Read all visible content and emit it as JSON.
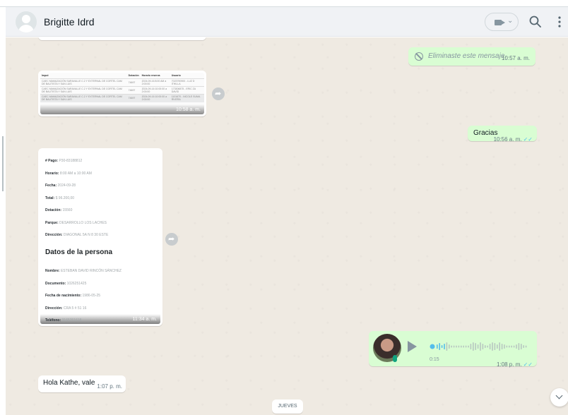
{
  "header": {
    "contact_name": "Brigitte Idrd",
    "avatar_icon": "default-user-avatar-icon",
    "video_icon": "video-camera-icon",
    "search_icon": "search-icon",
    "menu_icon": "kebab-menu-icon"
  },
  "messages": {
    "deleted": {
      "text": "Eliminaste este mensaje.",
      "time": "10:57 a. m.",
      "icon": "ban-icon"
    },
    "table_image": {
      "time": "10:58 a. m.",
      "headers": [
        "Imput",
        "Dotación",
        "Horario reserva",
        "Usuario"
      ],
      "rows": [
        [
          "CAEC MAMAZACIÓN SARAVALLE C.2 Y EXTERNAL DE CORTEL CAM DE BAUTISTA Y SAN LUIS",
          "74697",
          "2024-09-16 8:00 AM a 2:00:00",
          "7023790900 - LUZ D ITHILLA"
        ],
        [
          "CAEC MAMAZACIÓN SARAVALLE C.2 Y EXTERNAL DE CORTEL CAM DE BAUTISTA Y SAN LUIS",
          "74697",
          "2024-09-16 10:00:00 a 2:00:00",
          "173306875 - ERIC ZA DAVID"
        ],
        [
          "CAEC MAMAZACIÓN SARAVALLE C.2 Y EXTERNAL DE CORTEL CAM DE BAUTISTA Y SAN LUIS",
          "74697",
          "2024-09-16 10:00:00 a 2:00:00",
          "1101670 - NICOLE SUMA RIVERA"
        ]
      ]
    },
    "gracias": {
      "text": "Gracias",
      "time": "10:56 a. m."
    },
    "reservation_card": {
      "time": "11:34 a. m.",
      "fields": [
        {
          "label": "# Pago:",
          "value": "P30-83188812"
        },
        {
          "label": "Horario:",
          "value": "8:00 AM a 10:00 AM"
        },
        {
          "label": "Fecha:",
          "value": "2024-09-28"
        },
        {
          "label": "Total:",
          "value": "$ 96.200,00"
        },
        {
          "label": "Dotación:",
          "value": "15560"
        },
        {
          "label": "Parque:",
          "value": "DESARROLLO LOS LACHES"
        },
        {
          "label": "Dirección:",
          "value": "DIAGONAL 5A N 8 30 ESTE"
        }
      ],
      "section_title": "Datos de la persona",
      "person_fields": [
        {
          "label": "Nombre:",
          "value": "ESTEBAN DAVID RINCÓN SÁNCHEZ"
        },
        {
          "label": "Documento:",
          "value": "1026251425"
        },
        {
          "label": "Fecha de nacimiento:",
          "value": "1986-05-25"
        },
        {
          "label": "Dirección:",
          "value": "CRA 5 # 51 16"
        },
        {
          "label": "Teléfono:",
          "value": "3165761618"
        }
      ]
    },
    "voice_note": {
      "duration": "0:15",
      "time": "1:08 p. m.",
      "play_icon": "play-icon",
      "mic_icon": "microphone-icon"
    },
    "hola": {
      "text": "Hola Kathe, vale",
      "time": "1:07 p. m."
    }
  },
  "day_chip": "JUEVES",
  "icons": {
    "forward": "forward-icon",
    "scroll_down": "chevron-down-icon"
  },
  "colors": {
    "outgoing": "#d9fdd3",
    "incoming": "#ffffff",
    "chat_bg": "#efeae2",
    "read_check": "#53bdeb"
  }
}
